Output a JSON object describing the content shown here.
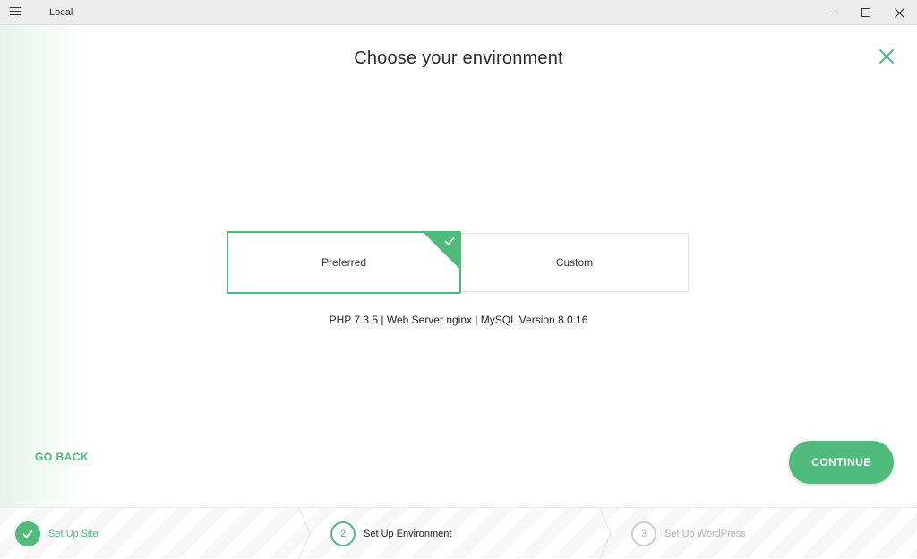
{
  "window": {
    "title": "Local",
    "minimize_icon": "minimize-icon",
    "maximize_icon": "maximize-icon",
    "close_icon": "close-icon"
  },
  "header": {
    "title": "Choose your environment",
    "close_icon": "close-icon"
  },
  "options": [
    {
      "label": "Preferred",
      "selected": true
    },
    {
      "label": "Custom",
      "selected": false
    }
  ],
  "environment_info": "PHP 7.3.5 | Web Server nginx | MySQL Version 8.0.16",
  "actions": {
    "go_back": "GO BACK",
    "continue": "CONTINUE"
  },
  "steps": [
    {
      "number": "1",
      "label": "Set Up Site",
      "state": "complete"
    },
    {
      "number": "2",
      "label": "Set Up Environment",
      "state": "active"
    },
    {
      "number": "3",
      "label": "Set Up WordPress",
      "state": "pending"
    }
  ],
  "colors": {
    "accent": "#51bb7b",
    "pending": "#b5b5b5"
  }
}
